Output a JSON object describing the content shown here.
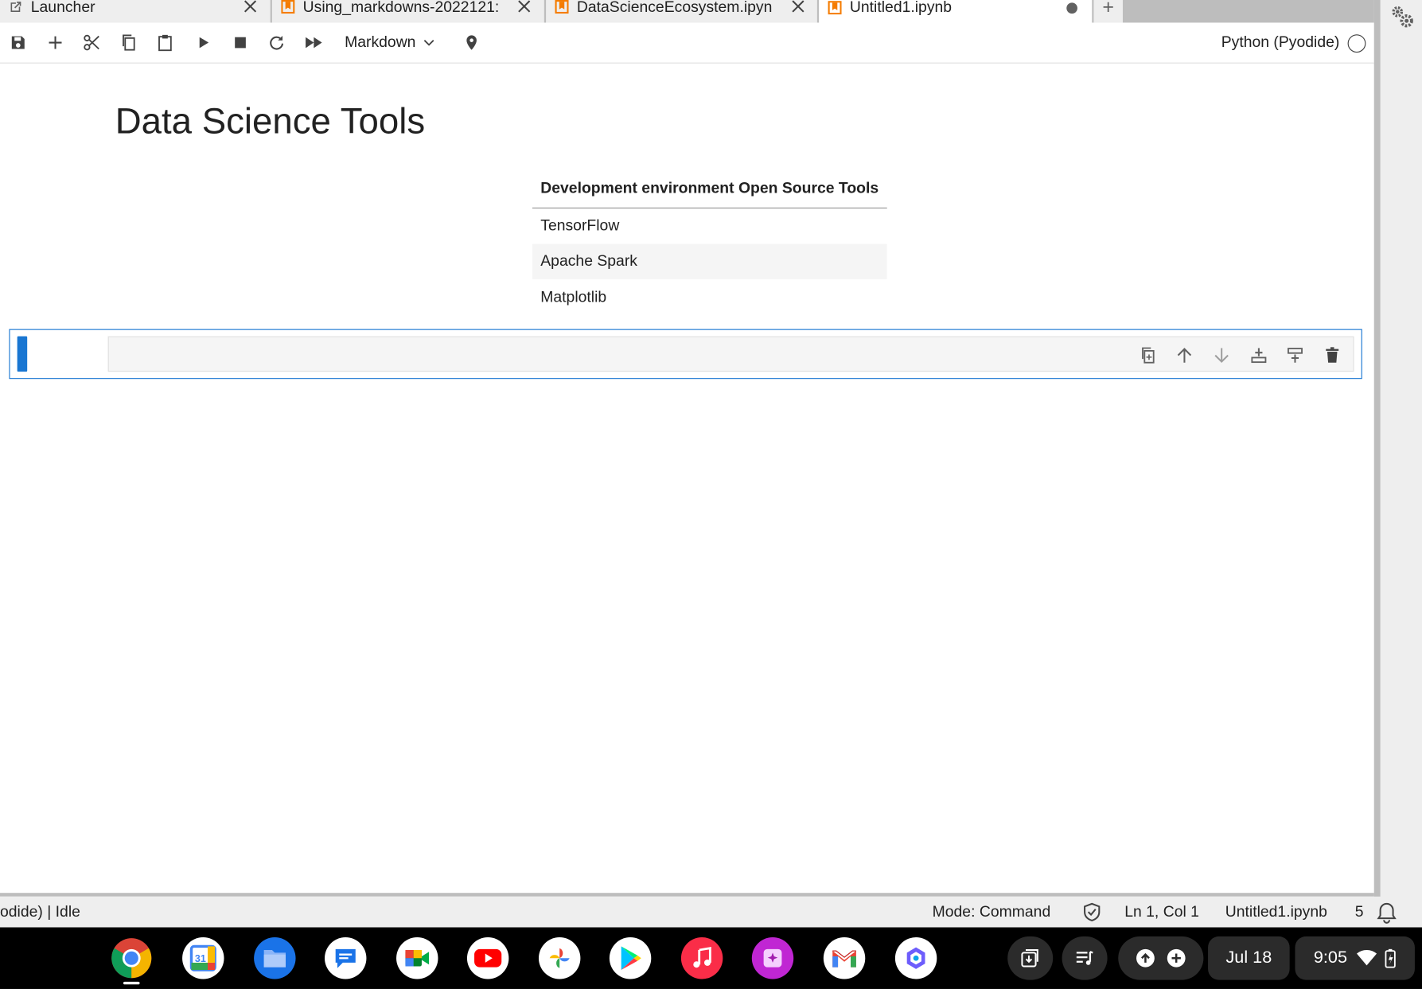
{
  "tabs": [
    {
      "label": "Launcher",
      "icon": "external-link-icon",
      "closable": true
    },
    {
      "label": "Using_markdowns-2022121:",
      "icon": "notebook-icon",
      "closable": true
    },
    {
      "label": "DataScienceEcosystem.ipyn",
      "icon": "notebook-icon",
      "closable": true
    },
    {
      "label": "Untitled1.ipynb",
      "icon": "notebook-icon",
      "active": true,
      "unsaved": true
    }
  ],
  "toolbar": {
    "buttons": [
      "save-icon",
      "add-cell-icon",
      "cut-icon",
      "copy-icon",
      "paste-icon",
      "run-icon",
      "stop-icon",
      "restart-icon",
      "fast-forward-icon"
    ],
    "cell_type": "Markdown",
    "kernel_name": "Python (Pyodide)",
    "kernel_status": "idle"
  },
  "notebook": {
    "heading": "Data Science Tools",
    "table": {
      "header": "Development environment Open Source Tools",
      "rows": [
        "TensorFlow",
        "Apache Spark",
        "Matplotlib"
      ]
    },
    "cell_tools": [
      "duplicate-icon",
      "move-up-icon",
      "move-down-icon",
      "insert-above-icon",
      "insert-below-icon",
      "delete-icon"
    ]
  },
  "statusbar": {
    "kernel_text": "odide) | Idle",
    "mode": "Mode: Command",
    "position": "Ln 1, Col 1",
    "filename": "Untitled1.ipynb",
    "notifications": "5"
  },
  "shelf": {
    "apps": [
      "chrome",
      "calendar",
      "files",
      "messages",
      "meet",
      "youtube",
      "photos",
      "play-store",
      "music",
      "gallery",
      "gmail",
      "copilot"
    ],
    "calendar_day": "31",
    "date": "Jul 18",
    "time": "9:05"
  },
  "colors": {
    "accent": "#1976d2",
    "notebook_orange": "#f57c00",
    "tabbar": "#bdbdbd",
    "shelf": "#000000"
  }
}
